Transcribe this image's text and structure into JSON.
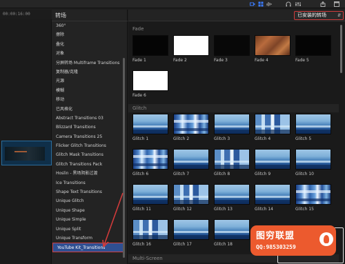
{
  "toolbar": {
    "icons": [
      "video-icon",
      "grid-icon",
      "audio-icon",
      "headphones-icon",
      "equalizer-icon",
      "share-icon",
      "window-icon"
    ]
  },
  "timecode": "00:00:16:00",
  "categories": {
    "title": "转场",
    "items": [
      "360°",
      "擦除",
      "叠化",
      "对象",
      "分屏转场 Multiframe Transitions",
      "复制器/克隆",
      "光源",
      "模糊",
      "移动",
      "已风格化",
      "Abstract Transitions 03",
      "Blizzard Transitions",
      "Camera Transitions 25",
      "Flicker Glitch Transitions",
      "Glitch Mask Transitions",
      "Glitch Transitions Pack",
      "Hoslin - 黑场阴影过渡",
      "Ice Transitions",
      "Shape Text Transitions",
      "Unique Glitch",
      "Unique Shape",
      "Unique Simple",
      "Unique Split",
      "Unique Transform",
      "YouTube Kit_Transitions"
    ],
    "selected_index": 24
  },
  "browser": {
    "installed_label": "已安装的转场",
    "sections": [
      {
        "title": "Fade",
        "items": [
          "Fade 1",
          "Fade 2",
          "Fade 3",
          "Fade 4",
          "Fade 5",
          "Fade 6"
        ]
      },
      {
        "title": "Glitch",
        "items": [
          "Glitch 1",
          "Glitch 2",
          "Glitch 3",
          "Glitch 4",
          "Glitch 5",
          "Glitch 6",
          "Glitch 7",
          "Glitch 8",
          "Glitch 9",
          "Glitch 10",
          "Glitch 11",
          "Glitch 12",
          "Glitch 13",
          "Glitch 14",
          "Glitch 15",
          "Glitch 16",
          "Glitch 17",
          "Glitch 18"
        ]
      },
      {
        "title": "Multi-Screen",
        "items": []
      }
    ]
  },
  "watermark": {
    "title": "图穷联盟",
    "qq": "QQ:985303259"
  },
  "colors": {
    "selection": "#2f4f92",
    "highlight_red": "#d13b3b",
    "watermark_orange": "#ec5a2e",
    "toolbar_accent": "#3a7bff"
  }
}
